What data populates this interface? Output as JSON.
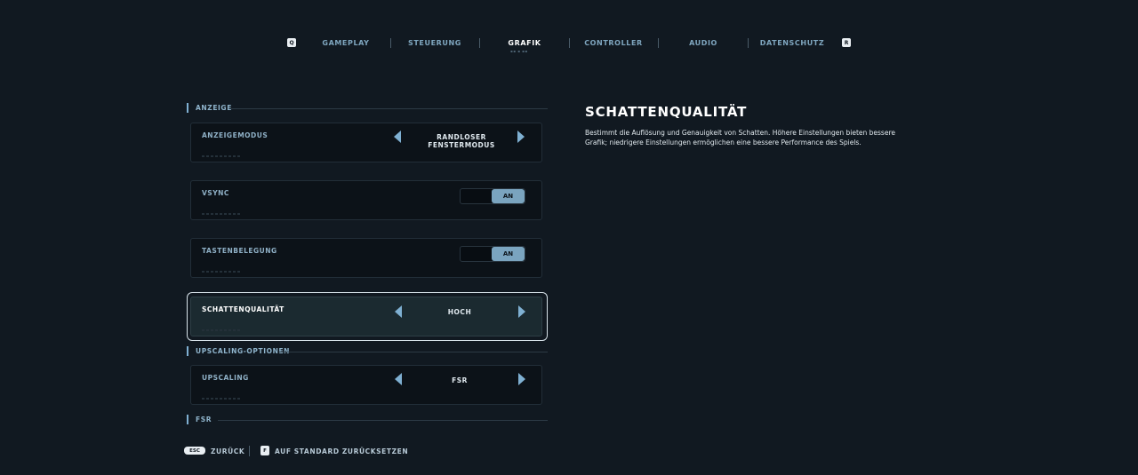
{
  "nav": {
    "left_key": "Q",
    "right_key": "R",
    "tabs": [
      {
        "label": "GAMEPLAY"
      },
      {
        "label": "STEUERUNG"
      },
      {
        "label": "GRAFIK",
        "active": true
      },
      {
        "label": "CONTROLLER"
      },
      {
        "label": "AUDIO"
      },
      {
        "label": "DATENSCHUTZ"
      }
    ]
  },
  "sections": {
    "anzeige": "ANZEIGE",
    "upscaling": "UPSCALING-OPTIONEN",
    "fsr": "FSR"
  },
  "settings": {
    "anzeigemodus": {
      "label": "ANZEIGEMODUS",
      "value": "RANDLOSER FENSTERMODUS"
    },
    "vsync": {
      "label": "VSYNC",
      "value": "AN"
    },
    "tastenbelegung": {
      "label": "TASTENBELEGUNG",
      "value": "AN"
    },
    "schattenqualitaet": {
      "label": "SCHATTENQUALITÄT",
      "value": "HOCH"
    },
    "upscaling": {
      "label": "UPSCALING",
      "value": "FSR"
    }
  },
  "detail": {
    "title": "SCHATTENQUALITÄT",
    "description": "Bestimmt die Auflösung und Genauigkeit von Schatten. Höhere Einstellungen bieten bessere Grafik; niedrigere Einstellungen ermöglichen eine bessere Performance des Spiels."
  },
  "footer": {
    "back_key": "ESC",
    "back_label": "ZURÜCK",
    "reset_key": "F",
    "reset_label": "AUF STANDARD ZURÜCKSETZEN"
  },
  "colors": {
    "background": "#111921",
    "accent": "#7fb0d2",
    "toggle_on": "#7aa4bf"
  }
}
